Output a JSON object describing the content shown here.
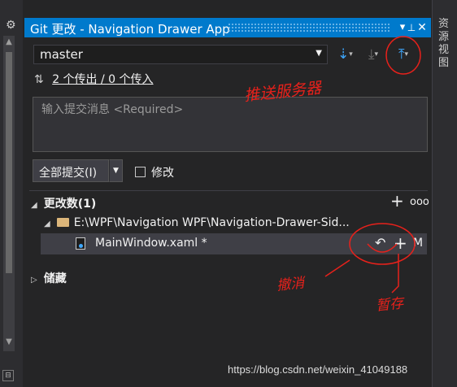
{
  "side": {
    "gear_icon": "gear-icon",
    "right_tab": "资源视图"
  },
  "panel": {
    "title": "Git 更改 - Navigation Drawer App",
    "title_buttons": {
      "menu": "▾",
      "pin": "📌",
      "close": "✕"
    }
  },
  "branch": {
    "value": "master"
  },
  "toolbar": {
    "fetch_icon": "fetch-icon",
    "pull_icon": "pull-icon",
    "push_icon": "push-icon"
  },
  "sync": {
    "link": "2 个传出 / 0 个传入"
  },
  "commit": {
    "placeholder": "输入提交消息 <Required>",
    "button_label": "全部提交(I)",
    "amend_label": "修改"
  },
  "changes": {
    "header": "更改数(1)",
    "folder_path": "E:\\WPF\\Navigation WPF\\Navigation-Drawer-Sid...",
    "files": [
      {
        "name": "MainWindow.xaml *",
        "status": "M"
      }
    ]
  },
  "stashes": {
    "header": "储藏"
  },
  "annotations": {
    "push": "推送服务器",
    "undo": "撤消",
    "stage": "暂存",
    "color": "#e8211b"
  },
  "watermark": "https://blog.csdn.net/weixin_41049188"
}
